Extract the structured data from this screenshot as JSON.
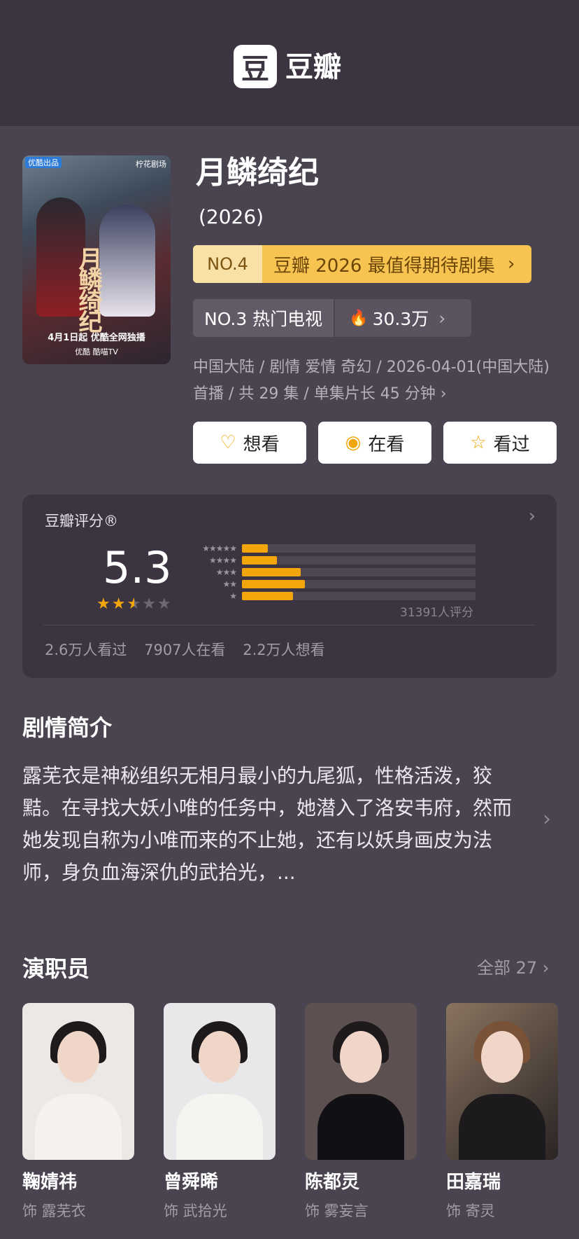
{
  "header": {
    "logo_char": "豆",
    "logo_text": "豆瓣"
  },
  "show": {
    "title": "月鳞绮纪",
    "year": "(2026)",
    "poster": {
      "tag": "优酷出品",
      "studio": "柠花剧场",
      "title_art": "月鳞绮纪",
      "date_line": "4月1日起 优酷全网独播",
      "platforms": "优酷 酷喵TV"
    },
    "rank": {
      "no": "NO.4",
      "text": "豆瓣 2026 最值得期待剧集",
      "arrow": "›"
    },
    "hot": {
      "label": "NO.3 热门电视",
      "fire_icon": "fire-icon",
      "count": "30.3万",
      "arrow": "›"
    },
    "info": "中国大陆 / 剧情 爱情 奇幻 / 2026-04-01(中国大陆) 首播 / 共 29 集 / 单集片长 45 分钟 ›"
  },
  "actions": [
    {
      "label": "想看",
      "icon": "heart-plus-icon",
      "glyph": "♡"
    },
    {
      "label": "在看",
      "icon": "target-icon",
      "glyph": "◉"
    },
    {
      "label": "看过",
      "icon": "star-outline-icon",
      "glyph": "☆"
    }
  ],
  "rating": {
    "label": "豆瓣评分®",
    "score": "5.3",
    "stars_value": 2.5,
    "stars_display": {
      "on": "★★",
      "half": "★",
      "off": "★★"
    },
    "distribution": [
      {
        "stars": "★★★★★",
        "fraction": 0.11
      },
      {
        "stars": "★★★★",
        "fraction": 0.15
      },
      {
        "stars": "★★★",
        "fraction": 0.25
      },
      {
        "stars": "★★",
        "fraction": 0.27
      },
      {
        "stars": "★",
        "fraction": 0.22
      }
    ],
    "count": "31391人评分",
    "stats": [
      "2.6万人看过",
      "7907人在看",
      "2.2万人想看"
    ]
  },
  "synopsis": {
    "title": "剧情简介",
    "text": "露芜衣是神秘组织无相月最小的九尾狐，性格活泼，狡黠。在寻找大妖小唯的任务中，她潜入了洛安韦府，然而她发现自称为小唯而来的不止她，还有以妖身画皮为法师，身负血海深仇的武拾光，..."
  },
  "cast": {
    "title": "演职员",
    "all_label": "全部 27 ›",
    "members": [
      {
        "name": "鞠婧祎",
        "role": "饰 露芜衣"
      },
      {
        "name": "曾舜晞",
        "role": "饰 武拾光"
      },
      {
        "name": "陈都灵",
        "role": "饰 雾妄言"
      },
      {
        "name": "田嘉瑞",
        "role": "饰 寄灵"
      }
    ]
  },
  "colors": {
    "background": "#4a4350",
    "header": "#3c3541",
    "accent": "#f2a60a",
    "rank_bar": "#f7c451"
  }
}
